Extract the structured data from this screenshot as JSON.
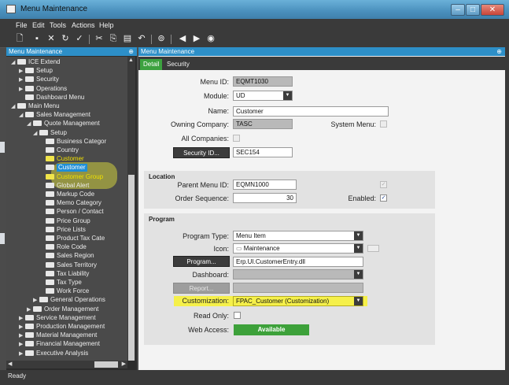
{
  "window": {
    "title": "Menu Maintenance"
  },
  "menubar": [
    "File",
    "Edit",
    "Tools",
    "Actions",
    "Help"
  ],
  "toolbar_icons": [
    "new-icon",
    "save-icon",
    "delete-icon",
    "refresh-icon",
    "check-icon",
    "cut-icon",
    "copy-icon",
    "paste-icon",
    "undo-icon",
    "binoculars-icon",
    "back-icon",
    "forward-icon",
    "clipboard-icon"
  ],
  "left_panel": {
    "title": "Menu Maintenance",
    "pin": "⊕",
    "tree": [
      {
        "label": "ICE Extend",
        "depth": 0,
        "arrow": "◢"
      },
      {
        "label": "Setup",
        "depth": 1,
        "arrow": "▶"
      },
      {
        "label": "Security",
        "depth": 1,
        "arrow": "▶"
      },
      {
        "label": "Operations",
        "depth": 1,
        "arrow": "▶"
      },
      {
        "label": "Dashboard Menu",
        "depth": 1,
        "arrow": ""
      },
      {
        "label": "Main Menu",
        "depth": 0,
        "arrow": "◢"
      },
      {
        "label": "Sales Management",
        "depth": 1,
        "arrow": "◢"
      },
      {
        "label": "Quote Management",
        "depth": 2,
        "arrow": "◢"
      },
      {
        "label": "Setup",
        "depth": 3,
        "arrow": "◢"
      },
      {
        "label": "Business Categor",
        "depth": 4,
        "arrow": ""
      },
      {
        "label": "Country",
        "depth": 4,
        "arrow": ""
      },
      {
        "label": "Customer",
        "depth": 4,
        "arrow": "",
        "style": "hl"
      },
      {
        "label": "Customer",
        "depth": 4,
        "arrow": "",
        "style": "sel"
      },
      {
        "label": "Customer Group",
        "depth": 4,
        "arrow": "",
        "style": "hl"
      },
      {
        "label": "Global Alert",
        "depth": 4,
        "arrow": ""
      },
      {
        "label": "Markup Code",
        "depth": 4,
        "arrow": ""
      },
      {
        "label": "Memo Category",
        "depth": 4,
        "arrow": ""
      },
      {
        "label": "Person / Contact",
        "depth": 4,
        "arrow": ""
      },
      {
        "label": "Price Group",
        "depth": 4,
        "arrow": ""
      },
      {
        "label": "Price Lists",
        "depth": 4,
        "arrow": ""
      },
      {
        "label": "Product Tax Cate",
        "depth": 4,
        "arrow": ""
      },
      {
        "label": "Role Code",
        "depth": 4,
        "arrow": ""
      },
      {
        "label": "Sales Region",
        "depth": 4,
        "arrow": ""
      },
      {
        "label": "Sales Territory",
        "depth": 4,
        "arrow": ""
      },
      {
        "label": "Tax Liability",
        "depth": 4,
        "arrow": ""
      },
      {
        "label": "Tax Type",
        "depth": 4,
        "arrow": ""
      },
      {
        "label": "Work Force",
        "depth": 4,
        "arrow": ""
      },
      {
        "label": "General Operations",
        "depth": 3,
        "arrow": "▶"
      },
      {
        "label": "Order Management",
        "depth": 2,
        "arrow": "▶"
      },
      {
        "label": "Service Management",
        "depth": 1,
        "arrow": "▶"
      },
      {
        "label": "Production Management",
        "depth": 1,
        "arrow": "▶"
      },
      {
        "label": "Material Management",
        "depth": 1,
        "arrow": "▶"
      },
      {
        "label": "Financial Management",
        "depth": 1,
        "arrow": "▶"
      },
      {
        "label": "Executive Analysis",
        "depth": 1,
        "arrow": "▶"
      }
    ]
  },
  "right_panel": {
    "title": "Menu Maintenance",
    "pin": "⊕",
    "tabs": [
      "Detail",
      "Security"
    ],
    "detail": {
      "menu_id_label": "Menu ID:",
      "menu_id": "EQMT1030",
      "module_label": "Module:",
      "module": "UD",
      "name_label": "Name:",
      "name": "Customer",
      "owning_company_label": "Owning Company:",
      "owning_company": "TASC",
      "system_menu_label": "System Menu:",
      "all_companies_label": "All Companies:",
      "security_id_button": "Security ID...",
      "security_id": "SEC154"
    },
    "location": {
      "title": "Location",
      "parent_menu_id_label": "Parent Menu ID:",
      "parent_menu_id": "EQMN1000",
      "order_sequence_label": "Order Sequence:",
      "order_sequence": "30",
      "enabled_label": "Enabled:"
    },
    "program": {
      "title": "Program",
      "program_type_label": "Program Type:",
      "program_type": "Menu Item",
      "icon_label": "Icon:",
      "icon": "Maintenance",
      "program_button": "Program...",
      "program": "Erp.UI.CustomerEntry.dll",
      "dashboard_label": "Dashboard:",
      "report_button": "Report...",
      "customization_label": "Customization:",
      "customization": "FPAC_Customer (Customization)",
      "read_only_label": "Read Only:",
      "web_access_label": "Web Access:",
      "web_access": "Available"
    }
  },
  "status": {
    "text": "Ready"
  },
  "colors": {
    "highlight": "#f5f04a",
    "accent": "#2d8fc8",
    "tab_active": "#3ca13f",
    "available": "#3da13a"
  }
}
